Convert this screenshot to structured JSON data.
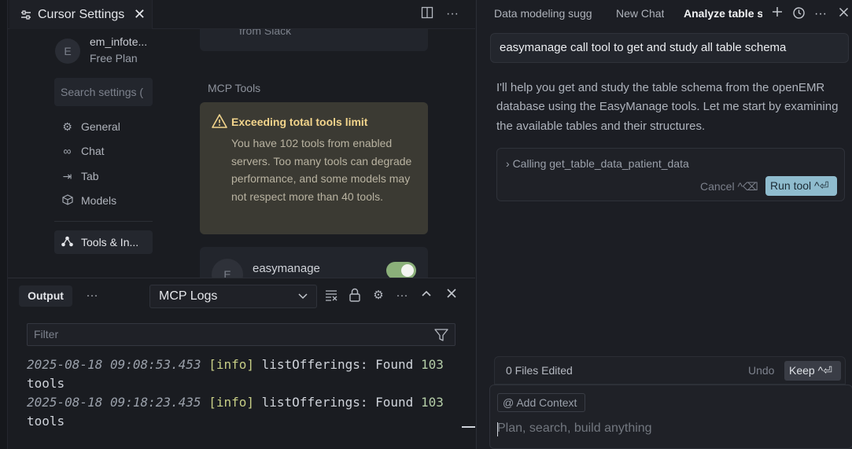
{
  "editor": {
    "tab_label": "Cursor Settings",
    "tab_close": "✕"
  },
  "settings": {
    "account": {
      "avatar_letter": "E",
      "name": "em_infote...",
      "plan": "Free Plan"
    },
    "search_placeholder": "Search settings (",
    "nav": [
      {
        "icon": "gear-icon",
        "label": "General"
      },
      {
        "icon": "infinity-icon",
        "label": "Chat"
      },
      {
        "icon": "arrow-right-bar-icon",
        "label": "Tab"
      },
      {
        "icon": "cube-icon",
        "label": "Models"
      },
      {
        "icon": "network-icon",
        "label": "Tools & In..."
      }
    ],
    "slack_fragment": "from Slack",
    "mcp_section_title": "MCP Tools",
    "warning": {
      "title": "Exceeding total tools limit",
      "body": "You have 102 tools from enabled servers. Too many tools can degrade performance, and some models may not respect more than 40 tools."
    },
    "server": {
      "avatar_letter": "E",
      "name": "easymanage",
      "enabled": true
    }
  },
  "panel": {
    "output_tab": "Output",
    "more": "···",
    "channel_select": "MCP Logs",
    "filter_placeholder": "Filter",
    "logs": [
      {
        "timestamp": "2025-08-18 09:08:53.453",
        "level": "[info]",
        "message": "listOfferings: Found",
        "count": "103",
        "tail": "tools"
      },
      {
        "timestamp": "2025-08-18 09:18:23.435",
        "level": "[info]",
        "message": "listOfferings: Found",
        "count": "103",
        "tail": "tools"
      }
    ]
  },
  "chat": {
    "tabs": [
      "Data modeling sugg",
      "New Chat",
      "Analyze table s"
    ],
    "user_message": "easymanage call tool to get and study all table schema",
    "assistant_message": "I'll help you get and study the table schema from the openEMR database using the EasyManage tools. Let me start by examining the available tables and their structures.",
    "tool_call": "Calling get_table_data_patient_data",
    "cancel_label": "Cancel ^⌫",
    "run_label": "Run tool ^⏎",
    "files_edited": "0 Files Edited",
    "undo_label": "Undo",
    "keep_label": "Keep ^⏎",
    "add_context": "Add Context",
    "prompt_placeholder": "Plan, search, build anything"
  },
  "colors": {
    "accent": "#8fbcce",
    "warning_title": "#f3d58c",
    "toggle_on": "#8bb07a"
  }
}
